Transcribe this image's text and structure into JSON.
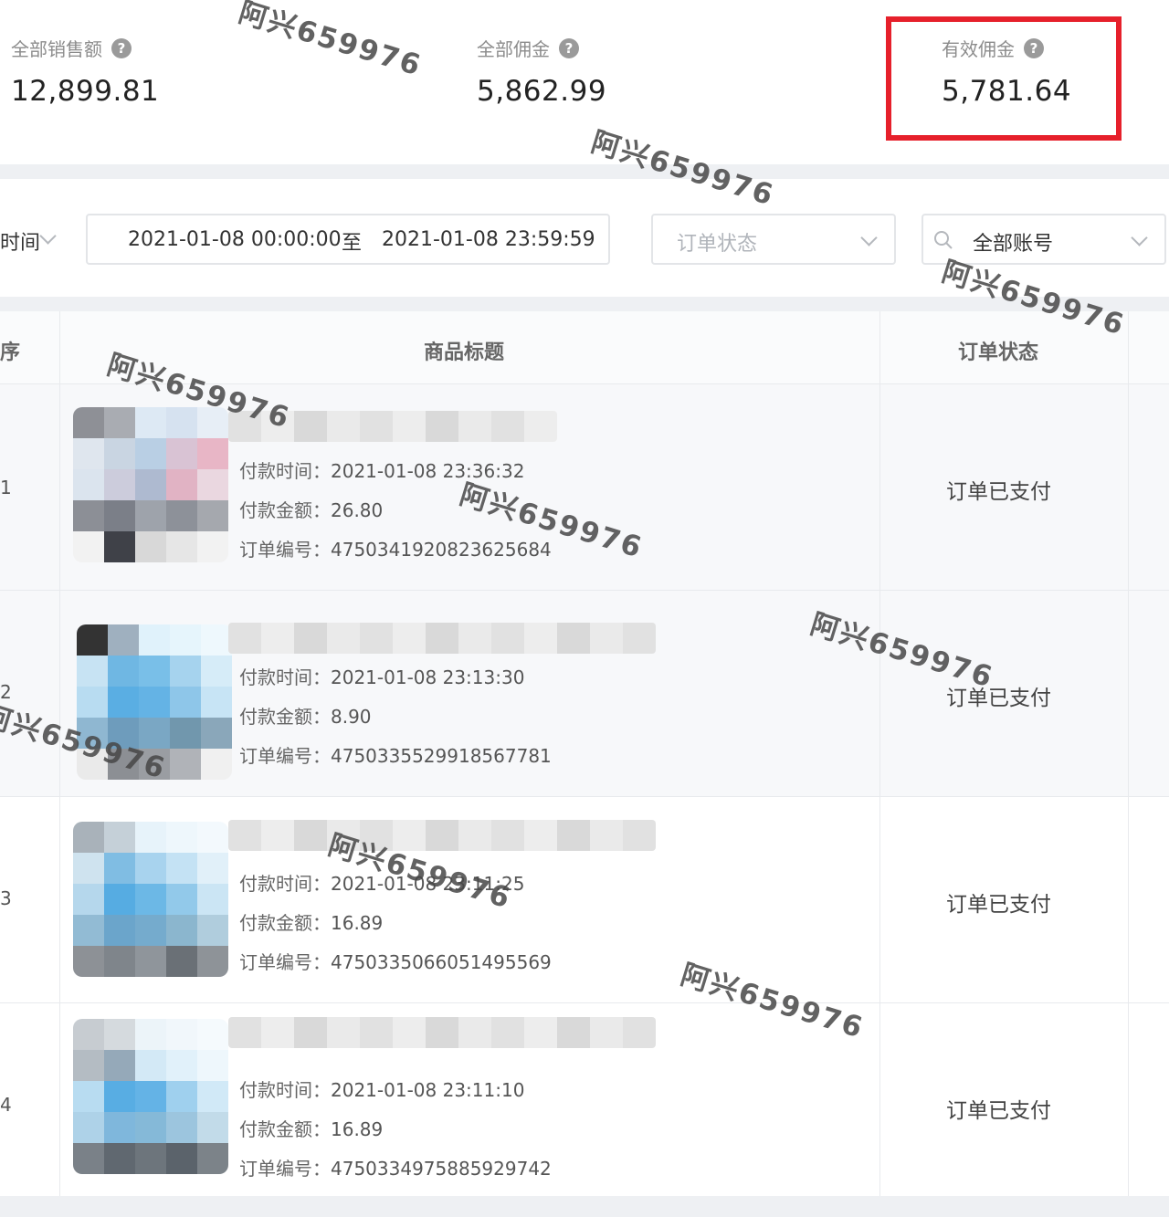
{
  "stats": [
    {
      "label": "全部销售额",
      "value": "12,899.81"
    },
    {
      "label": "全部佣金",
      "value": "5,862.99"
    },
    {
      "label": "有效佣金",
      "value": "5,781.64"
    }
  ],
  "filters": {
    "time_type_partial": "时间",
    "date_start": "2021-01-08 00:00:00",
    "date_sep": "至",
    "date_end": "2021-01-08 23:59:59",
    "order_status_placeholder": "订单状态",
    "account_value": "全部账号"
  },
  "table": {
    "col_partial": "序",
    "col_title": "商品标题",
    "col_status": "订单状态",
    "labels": {
      "pay_time": "付款时间：",
      "pay_amount": "付款金额：",
      "order_no": "订单编号："
    },
    "rows": [
      {
        "num": "1",
        "pay_time": "2021-01-08 23:36:32",
        "pay_amount": "26.80",
        "order_no": "4750341920823625684",
        "status": "订单已支付"
      },
      {
        "num": "2",
        "pay_time": "2021-01-08 23:13:30",
        "pay_amount": "8.90",
        "order_no": "4750335529918567781",
        "status": "订单已支付"
      },
      {
        "num": "3",
        "pay_time": "2021-01-08 23:11:25",
        "pay_amount": "16.89",
        "order_no": "4750335066051495569",
        "status": "订单已支付"
      },
      {
        "num": "4",
        "pay_time": "2021-01-08 23:11:10",
        "pay_amount": "16.89",
        "order_no": "4750334975885929742",
        "status": "订单已支付"
      }
    ]
  },
  "watermark": "阿兴659976",
  "colors": {
    "highlight": "#e6202b"
  }
}
